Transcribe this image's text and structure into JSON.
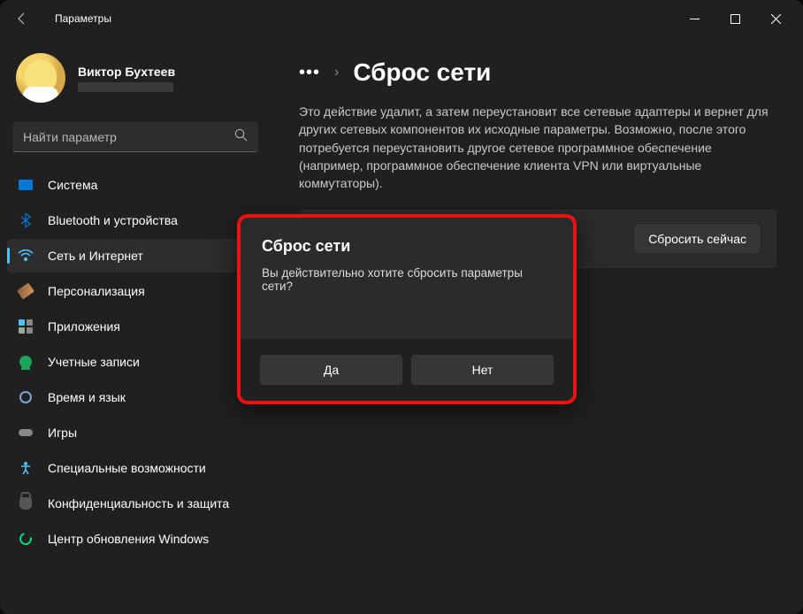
{
  "window": {
    "title": "Параметры"
  },
  "user": {
    "name": "Виктор Бухтеев"
  },
  "search": {
    "placeholder": "Найти параметр"
  },
  "sidebar": {
    "items": [
      {
        "label": "Система"
      },
      {
        "label": "Bluetooth и устройства"
      },
      {
        "label": "Сеть и Интернет"
      },
      {
        "label": "Персонализация"
      },
      {
        "label": "Приложения"
      },
      {
        "label": "Учетные записи"
      },
      {
        "label": "Время и язык"
      },
      {
        "label": "Игры"
      },
      {
        "label": "Специальные возможности"
      },
      {
        "label": "Конфиденциальность и защита"
      },
      {
        "label": "Центр обновления Windows"
      }
    ]
  },
  "breadcrumb": {
    "ellipsis": "•••",
    "sep": "›",
    "page": "Сброс сети"
  },
  "description": "Это действие удалит, а затем переустановит все сетевые адаптеры и вернет для других сетевых компонентов их исходные параметры. Возможно, после этого потребуется переустановить другое сетевое программное обеспечение (например, программное обеспечение клиента VPN или виртуальные коммутаторы).",
  "reset_button": "Сбросить сейчас",
  "dialog": {
    "title": "Сброс сети",
    "message": "Вы действительно хотите сбросить параметры сети?",
    "yes": "Да",
    "no": "Нет"
  }
}
